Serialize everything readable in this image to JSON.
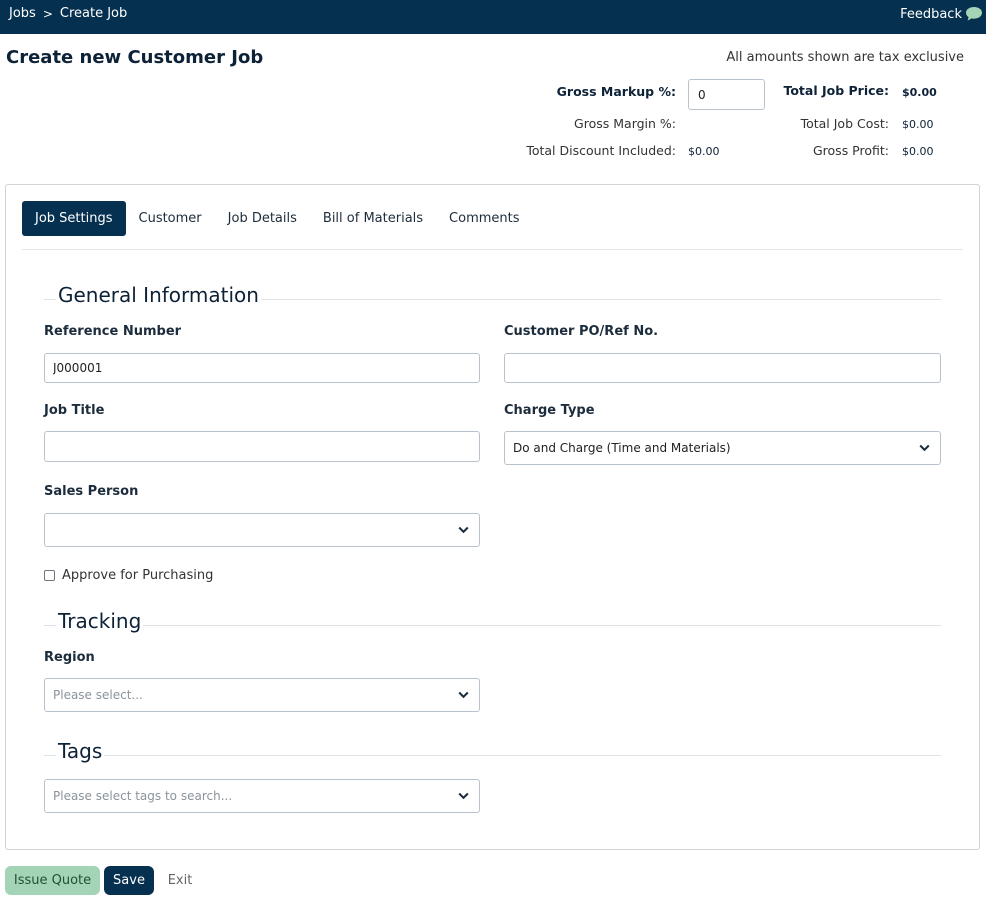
{
  "topbar": {
    "breadcrumbs": [
      "Jobs",
      "Create Job"
    ],
    "separator": ">",
    "feedback_label": "Feedback",
    "feedback_icon": "chat-bubble-icon"
  },
  "header": {
    "title": "Create new Customer Job",
    "tax_note": "All amounts shown are tax exclusive"
  },
  "summary": {
    "gross_markup_label": "Gross Markup %:",
    "gross_markup_value": "0",
    "gross_margin_label": "Gross Margin %:",
    "gross_margin_value": "",
    "total_discount_label": "Total Discount Included:",
    "total_discount_value": "$0.00",
    "total_job_price_label": "Total Job Price:",
    "total_job_price_value": "$0.00",
    "total_job_cost_label": "Total Job Cost:",
    "total_job_cost_value": "$0.00",
    "gross_profit_label": "Gross Profit:",
    "gross_profit_value": "$0.00"
  },
  "tabs": [
    {
      "label": "Job Settings",
      "active": true
    },
    {
      "label": "Customer",
      "active": false
    },
    {
      "label": "Job Details",
      "active": false
    },
    {
      "label": "Bill of Materials",
      "active": false
    },
    {
      "label": "Comments",
      "active": false
    }
  ],
  "general": {
    "heading": "General Information",
    "reference_number": {
      "label": "Reference Number",
      "value": "J000001"
    },
    "customer_po": {
      "label": "Customer PO/Ref No.",
      "value": ""
    },
    "job_title": {
      "label": "Job Title",
      "value": ""
    },
    "charge_type": {
      "label": "Charge Type",
      "value": "Do and Charge (Time and Materials)"
    },
    "sales_person": {
      "label": "Sales Person",
      "value": ""
    },
    "approve_purchasing": {
      "label": "Approve for Purchasing",
      "checked": false
    }
  },
  "tracking": {
    "heading": "Tracking",
    "region": {
      "label": "Region",
      "placeholder": "Please select..."
    }
  },
  "tags": {
    "heading": "Tags",
    "placeholder": "Please select tags to search..."
  },
  "actions": {
    "issue_quote": "Issue Quote",
    "save": "Save",
    "exit": "Exit"
  },
  "colors": {
    "navy": "#05304f",
    "quote_green": "#a3d4b5"
  }
}
